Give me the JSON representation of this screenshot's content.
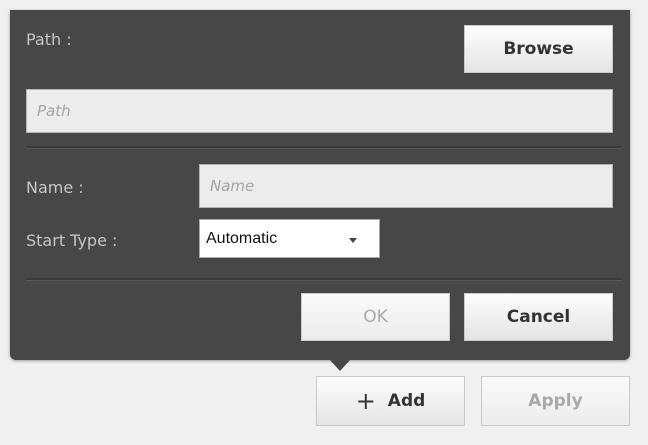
{
  "dialog": {
    "path_label": "Path :",
    "browse_label": "Browse",
    "path_placeholder": "Path",
    "name_label": "Name :",
    "name_placeholder": "Name",
    "start_type_label": "Start Type :",
    "start_type_value": "Automatic",
    "ok_label": "OK",
    "cancel_label": "Cancel"
  },
  "footer": {
    "add_label": "Add",
    "add_icon": "plus-icon",
    "apply_label": "Apply"
  },
  "colors": {
    "popup_bg": "#474747",
    "label_text": "#c6c6c6",
    "page_bg": "#f0f0f0"
  }
}
